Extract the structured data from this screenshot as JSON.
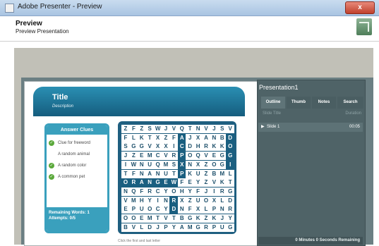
{
  "window": {
    "title": "Adobe Presenter - Preview",
    "close_glyph": "x"
  },
  "header": {
    "title": "Preview",
    "subtitle": "Preview Presentation",
    "logo_icon": "presenter-logo-icon"
  },
  "slide": {
    "title": "Title",
    "description": "Description",
    "clues": {
      "heading": "Answer Clues",
      "items": [
        {
          "label": "Clue for freeword",
          "checked": true
        },
        {
          "label": "A random animal",
          "checked": false
        },
        {
          "label": "A random color",
          "checked": true
        },
        {
          "label": "A common pet",
          "checked": true
        }
      ],
      "remaining": "Remaining Words: 1",
      "attempts": "Attempts: 0/5"
    },
    "grid_rows": [
      "ZFZSWJVQTNVJSV",
      "FLKTXZFAJXANBD",
      "SGGVXXICDHRKKO",
      "JZEMCVRPOQVEGG",
      "IWNUQMSXNXZOGI",
      "TFNANUTPKUZBML",
      "ORANGEWFEYZVKT",
      "NQFRCYOHYFJIRG",
      "VMHYINRXZUOXLD",
      "EPUOCYDNFXLPNR",
      "OOEMTVTBGKZKJY",
      "BVLDJPYAMGRPUG"
    ],
    "highlight_cells": [
      [
        1,
        7
      ],
      [
        2,
        7
      ],
      [
        3,
        7
      ],
      [
        4,
        7
      ],
      [
        5,
        7
      ],
      [
        6,
        0
      ],
      [
        6,
        1
      ],
      [
        6,
        2
      ],
      [
        6,
        3
      ],
      [
        6,
        4
      ],
      [
        6,
        5
      ],
      [
        6,
        6
      ],
      [
        8,
        6
      ],
      [
        9,
        6
      ],
      [
        1,
        13
      ],
      [
        2,
        13
      ],
      [
        3,
        13
      ],
      [
        4,
        13
      ]
    ],
    "hint": "Click the first and last letter"
  },
  "panel": {
    "title": "Presentation1",
    "tabs": [
      "Outline",
      "Thumb",
      "Notes",
      "Search"
    ],
    "col_title": "Slide Title",
    "col_duration": "Duration",
    "slides": [
      {
        "name": "Slide 1",
        "duration": "00:05"
      }
    ],
    "remaining": "0 Minutes 0 Seconds Remaining"
  }
}
